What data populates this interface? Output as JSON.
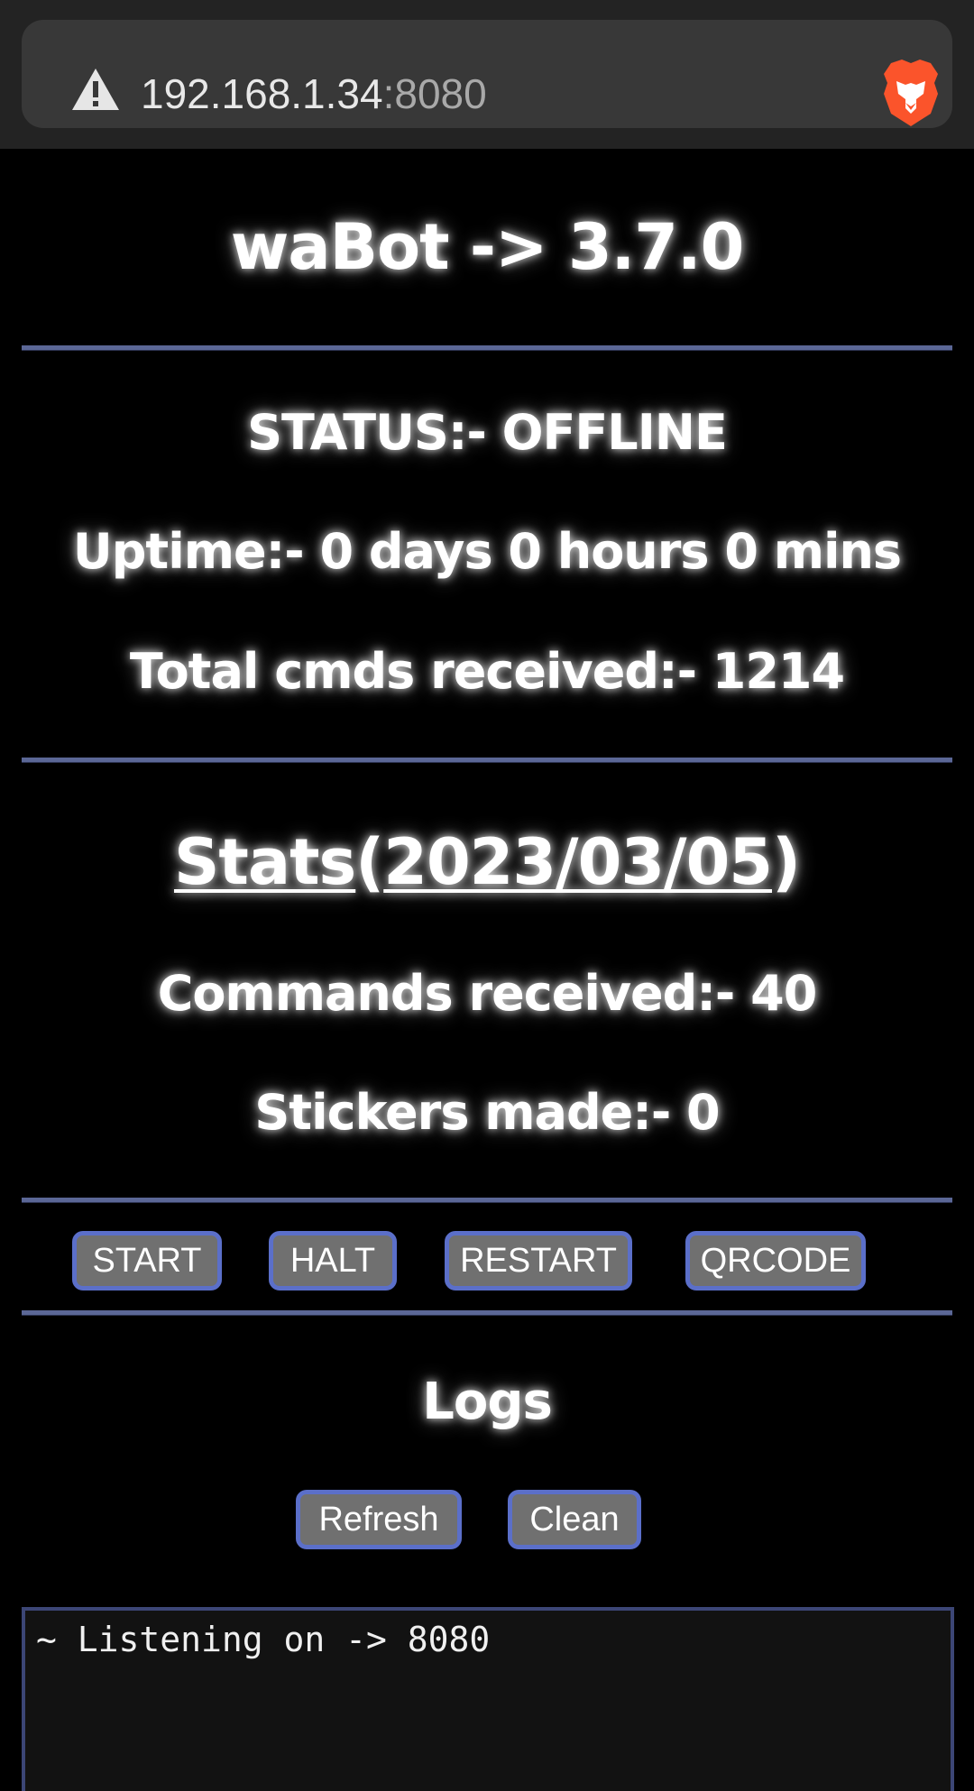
{
  "browser": {
    "url_host": "192.168.1.34",
    "url_port": ":8080",
    "warning_icon": "warning-triangle-icon",
    "browser_icon": "brave-lion-icon"
  },
  "header": {
    "title": "waBot -> 3.7.0"
  },
  "status": {
    "status_line": "STATUS:- OFFLINE",
    "uptime_line": "Uptime:- 0 days 0 hours 0 mins",
    "total_cmds_line": "Total cmds received:- 1214"
  },
  "stats": {
    "title_word": "Stats",
    "open_paren": "(",
    "date": "2023/03/05",
    "close_paren": ")",
    "commands_line": "Commands received:- 40",
    "stickers_line": "Stickers made:- 0"
  },
  "controls": {
    "start_label": "START",
    "halt_label": "HALT",
    "restart_label": "RESTART",
    "qrcode_label": "QRCODE"
  },
  "logs": {
    "title": "Logs",
    "refresh_label": "Refresh",
    "clean_label": "Clean",
    "log_text": "~ Listening on -> 8080"
  },
  "colors": {
    "background": "#000000",
    "divider": "#5b6796",
    "button_bg": "#707070",
    "button_border": "#5b6fc9"
  }
}
